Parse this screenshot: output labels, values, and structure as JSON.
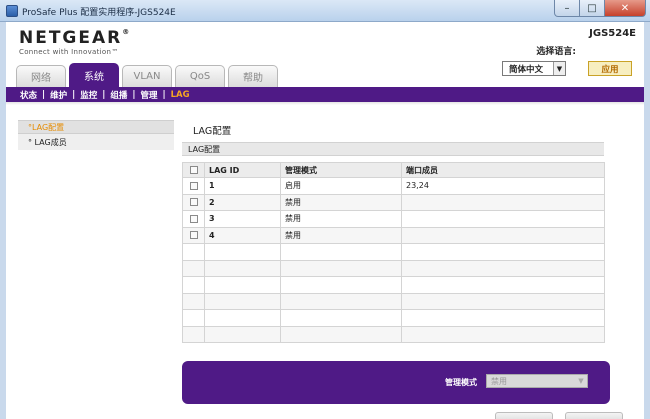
{
  "window": {
    "title": "ProSafe Plus 配置实用程序-JGS524E",
    "minimize": "–",
    "maximize": "□",
    "close": "✕"
  },
  "header": {
    "brand": "NETGEAR",
    "brand_mark": "®",
    "tagline": "Connect with Innovation™",
    "model": "JGS524E",
    "language_label": "选择语言:",
    "language_value": "简体中文",
    "apply_label": "应用"
  },
  "tabs": [
    {
      "label": "网络",
      "active": false
    },
    {
      "label": "系统",
      "active": true
    },
    {
      "label": "VLAN",
      "active": false
    },
    {
      "label": "QoS",
      "active": false
    },
    {
      "label": "帮助",
      "active": false
    }
  ],
  "subnav": [
    {
      "label": "状态",
      "active": false
    },
    {
      "label": "维护",
      "active": false
    },
    {
      "label": "监控",
      "active": false
    },
    {
      "label": "组播",
      "active": false
    },
    {
      "label": "管理",
      "active": false
    },
    {
      "label": "LAG",
      "active": true
    }
  ],
  "leftmenu": [
    {
      "label": "°LAG配置",
      "active": true
    },
    {
      "label": "° LAG成员",
      "active": false
    }
  ],
  "main": {
    "page_title": "LAG配置",
    "panel_title": "LAG配置",
    "columns": [
      "LAG ID",
      "管理模式",
      "端口成员"
    ],
    "rows": [
      {
        "id": "1",
        "mode": "启用",
        "members": "23,24"
      },
      {
        "id": "2",
        "mode": "禁用",
        "members": ""
      },
      {
        "id": "3",
        "mode": "禁用",
        "members": ""
      },
      {
        "id": "4",
        "mode": "禁用",
        "members": ""
      }
    ],
    "empty_rows": 6
  },
  "bottom": {
    "admin_mode_label": "管理模式",
    "admin_mode_value": "禁用"
  },
  "colors": {
    "brand_purple": "#4f1a86",
    "accent_orange": "#f6a623"
  }
}
